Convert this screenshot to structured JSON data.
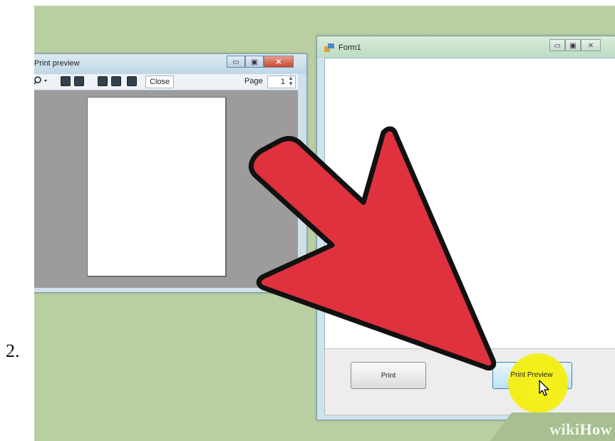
{
  "step_number": "2.",
  "print_preview": {
    "title": "Print preview",
    "toolbar": {
      "zoom_icon": "magnifier-icon",
      "close_label": "Close",
      "page_label": "Page",
      "page_value": "1"
    }
  },
  "form": {
    "title": "Form1",
    "buttons": {
      "print_label": "Print",
      "print_preview_label": "Print Preview"
    }
  },
  "watermark": {
    "part1": "wiki",
    "part2": "How"
  },
  "colors": {
    "arrow_fill": "#e0313e",
    "highlight": "#f3ee1a",
    "desktop": "#b9cfa2"
  }
}
